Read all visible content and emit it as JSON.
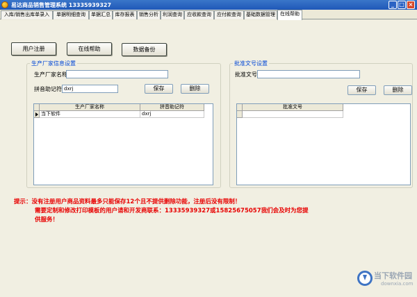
{
  "window": {
    "title": "易达商品销售管理系统 13335939327",
    "minimize": "_",
    "maximize": "□",
    "close": "×"
  },
  "tabs": [
    {
      "label": "入库/销售出库单录入"
    },
    {
      "label": "单据明细查询"
    },
    {
      "label": "单据汇总"
    },
    {
      "label": "库存报表"
    },
    {
      "label": "销售分析"
    },
    {
      "label": "利润查询"
    },
    {
      "label": "应收款查询"
    },
    {
      "label": "应付款查询"
    },
    {
      "label": "基础数据管理"
    },
    {
      "label": "在线帮助"
    }
  ],
  "toolbar": {
    "register": "用户注册",
    "online_help": "在线帮助",
    "backup": "数据备份"
  },
  "manufacturer": {
    "legend": "生产厂家信息设置",
    "name_label": "生产厂家名称",
    "name_value": "",
    "pinyin_label": "拼音助记符",
    "pinyin_value": "dxrj",
    "save": "保存",
    "delete": "删除",
    "table": {
      "columns": [
        "生产厂家名称",
        "拼音助记符"
      ],
      "rows": [
        [
          "当下软件",
          "dxrj"
        ]
      ]
    }
  },
  "approval": {
    "legend": "批准文号设置",
    "number_label": "批准文号",
    "number_value": "",
    "save": "保存",
    "delete": "删除",
    "table": {
      "columns": [
        "批准文号"
      ]
    }
  },
  "hint": {
    "line1": "提示：没有注册用户商品资料最多只能保存12个且不提供删除功能，注册后没有限制！",
    "line2": "需要定制和修改打印模板的用户请和开发商联系：13335939327或15825675057我们会及时为您提",
    "line3": "供服务！"
  },
  "watermark": {
    "name": "当下软件园",
    "url": "downxia.com"
  },
  "colors": {
    "titlebar": "#1f58b8",
    "legend": "#0046d5",
    "hint": "#e80000"
  }
}
